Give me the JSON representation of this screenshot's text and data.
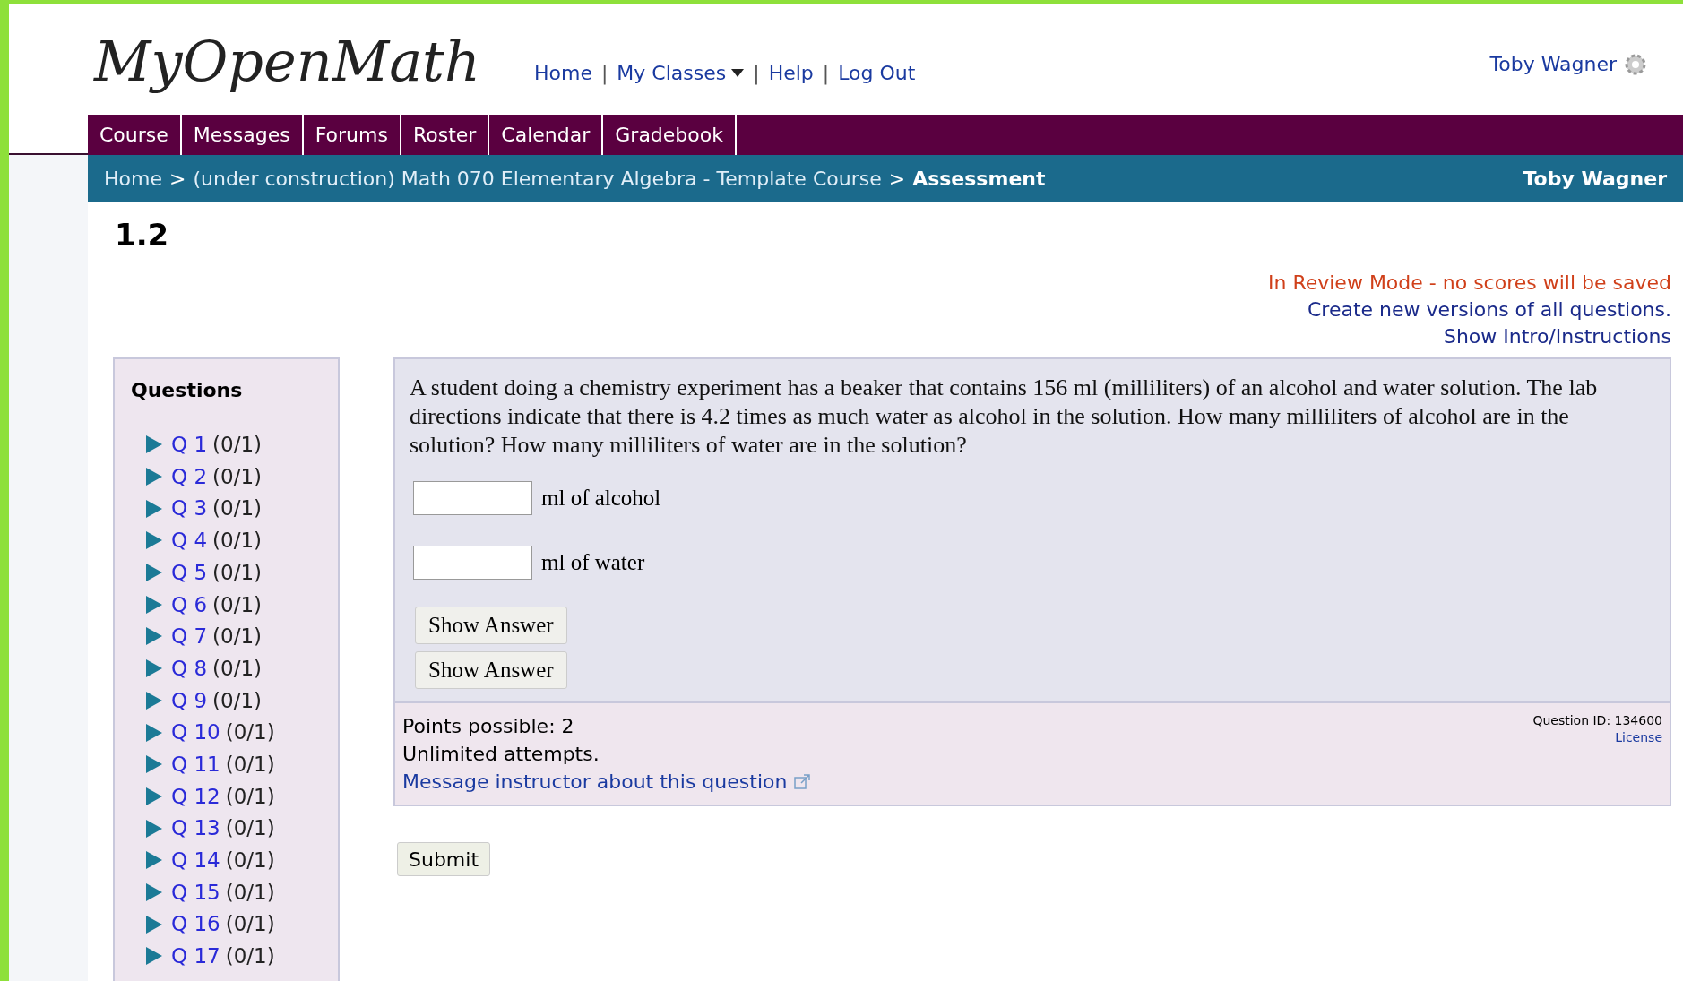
{
  "logo": "MyOpenMath",
  "top_nav": [
    {
      "label": "Home",
      "kind": "link"
    },
    {
      "label": "My Classes",
      "kind": "dropdown"
    },
    {
      "label": "Help",
      "kind": "link"
    },
    {
      "label": "Log Out",
      "kind": "link"
    }
  ],
  "nav_separator": "|",
  "user": {
    "name": "Toby Wagner"
  },
  "tabs": [
    "Course",
    "Messages",
    "Forums",
    "Roster",
    "Calendar",
    "Gradebook"
  ],
  "breadcrumb": {
    "separator": ">",
    "items": [
      "Home",
      "(under construction) Math 070 Elementary Algebra - Template Course"
    ],
    "current": "Assessment",
    "user": "Toby Wagner"
  },
  "title": "1.2",
  "notices": [
    {
      "text": "In Review Mode - no scores will be saved",
      "kind": "warning"
    },
    {
      "text": "Create new versions of all questions.",
      "kind": "link"
    },
    {
      "text": "Show Intro/Instructions",
      "kind": "link"
    }
  ],
  "sidebar": {
    "heading": "Questions",
    "items": [
      {
        "label": "Q 1",
        "score": "(0/1)"
      },
      {
        "label": "Q 2",
        "score": "(0/1)"
      },
      {
        "label": "Q 3",
        "score": "(0/1)"
      },
      {
        "label": "Q 4",
        "score": "(0/1)"
      },
      {
        "label": "Q 5",
        "score": "(0/1)"
      },
      {
        "label": "Q 6",
        "score": "(0/1)"
      },
      {
        "label": "Q 7",
        "score": "(0/1)"
      },
      {
        "label": "Q 8",
        "score": "(0/1)"
      },
      {
        "label": "Q 9",
        "score": "(0/1)"
      },
      {
        "label": "Q 10",
        "score": "(0/1)"
      },
      {
        "label": "Q 11",
        "score": "(0/1)"
      },
      {
        "label": "Q 12",
        "score": "(0/1)"
      },
      {
        "label": "Q 13",
        "score": "(0/1)"
      },
      {
        "label": "Q 14",
        "score": "(0/1)"
      },
      {
        "label": "Q 15",
        "score": "(0/1)"
      },
      {
        "label": "Q 16",
        "score": "(0/1)"
      },
      {
        "label": "Q 17",
        "score": "(0/1)"
      }
    ]
  },
  "question": {
    "text": "A student doing a chemistry experiment has a beaker that contains 156 ml (milliliters) of an alcohol and water solution. The lab directions indicate that there is 4.2 times as much water as alcohol in the solution. How many milliliters of alcohol are in the solution? How many milliliters of water are in the solution?",
    "answers": [
      {
        "unit": "ml of alcohol"
      },
      {
        "unit": "ml of water"
      }
    ],
    "buttons": [
      "Show Answer",
      "Show Answer"
    ],
    "points": "Points possible: 2",
    "attempts": "Unlimited attempts.",
    "message_link": "Message instructor about this question",
    "question_id": "Question ID: 134600",
    "license": "License"
  },
  "submit": "Submit"
}
